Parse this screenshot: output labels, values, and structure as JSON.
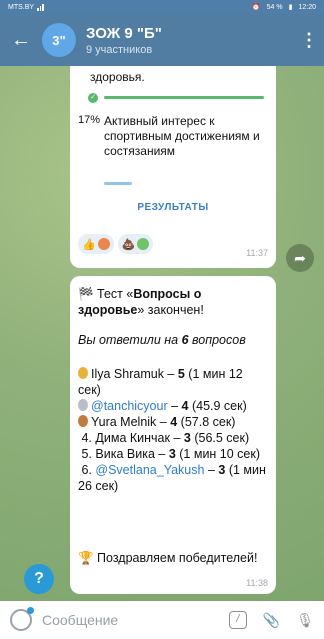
{
  "status": {
    "carrier": "MTS.BY",
    "battery": "54 %",
    "time": "12:20"
  },
  "header": {
    "avatar_text": "3\"",
    "title": "ЗОЖ 9 \"Б\"",
    "subtitle": "9 участников"
  },
  "poll": {
    "top_option": "здоровья.",
    "option2_pct": "17%",
    "option2_text": "Активный интерес к спортивным достижениям и состязаниям",
    "results_label": "РЕЗУЛЬТАТЫ",
    "time": "11:37"
  },
  "quiz_message": {
    "intro_prefix": "🏁 Тест «",
    "quiz_name": "Вопросы о здоровье",
    "intro_suffix": "» закончен!",
    "answered_prefix": "Вы ответили на ",
    "answered_count": "6",
    "answered_suffix": " вопросов",
    "results": [
      {
        "rank": "",
        "name": "Ilya Shramuk",
        "score": "5",
        "time": "(1 мин 12 сек)",
        "link": false
      },
      {
        "rank": "",
        "name": "@tanchicyour",
        "score": "4",
        "time": "(45.9 сек)",
        "link": true
      },
      {
        "rank": "",
        "name": "Yura Melnik",
        "score": "4",
        "time": "(57.8 сек)",
        "link": false
      },
      {
        "rank": "4.",
        "name": "Дима Кинчак",
        "score": "3",
        "time": "(56.5 сек)",
        "link": false
      },
      {
        "rank": "5.",
        "name": "Вика Вика",
        "score": "3",
        "time": "(1 мин 10 сек)",
        "link": false
      },
      {
        "rank": "6.",
        "name": "@Svetlana_Yakush",
        "score": "3",
        "time": "(1 мин 26 сек)",
        "link": true
      }
    ],
    "congrats": "🏆 Поздравляем победителей!",
    "time": "11:38"
  },
  "input": {
    "placeholder": "Сообщение"
  },
  "colors": {
    "header": "#527da3",
    "accent": "#2a9ad6",
    "progress": "#59b86b"
  }
}
